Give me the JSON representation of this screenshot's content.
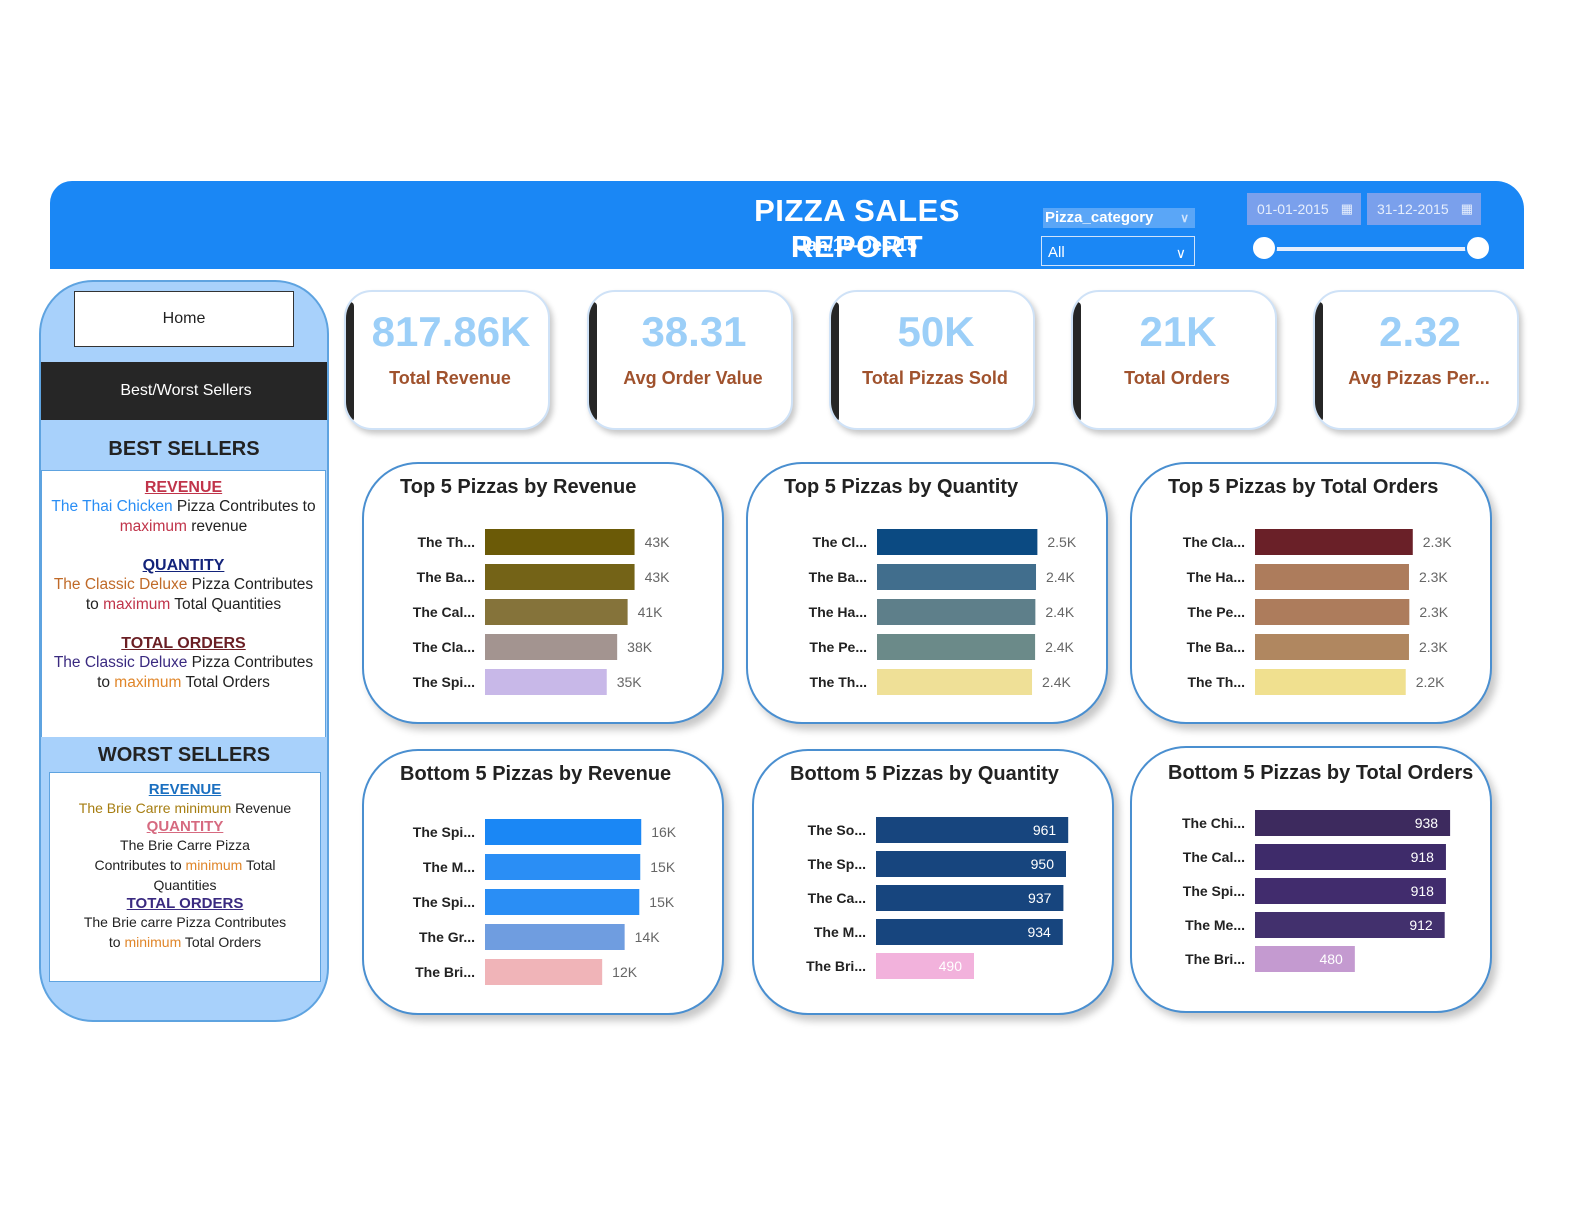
{
  "header": {
    "title": "PIZZA SALES REPORT",
    "subtitle": "Jan/15-Dec/15",
    "category_label": "Pizza_category",
    "category_value": "All",
    "date_start": "01-01-2015",
    "date_end": "31-12-2015",
    "colors": {
      "band": "#1a87f5"
    }
  },
  "sidebar": {
    "home_label": "Home",
    "best_worst_label": "Best/Worst Sellers",
    "best_title": "BEST SELLERS",
    "worst_title": "WORST SELLERS",
    "best": {
      "revenue_h": "REVENUE",
      "revenue_1": "The Thai Chicken",
      "revenue_2": " Pizza Contributes to",
      "revenue_3": "maximum",
      "revenue_4": " revenue",
      "quantity_h": "QUANTITY",
      "quantity_1": "The Classic Deluxe",
      "quantity_2": " Pizza Contributes",
      "quantity_3": "to ",
      "quantity_4": "maximum",
      "quantity_5": " Total Quantities",
      "orders_h": "TOTAL ORDERS",
      "orders_1": "The Classic Deluxe",
      "orders_2": " Pizza Contributes",
      "orders_3": "to ",
      "orders_4": "maximum",
      "orders_5": " Total Orders"
    },
    "worst": {
      "revenue_h": "REVENUE",
      "revenue_1": "The Brie Carre minimum",
      "revenue_2": " Revenue",
      "quantity_h": "QUANTITY",
      "quantity_1": "The Brie Carre Pizza",
      "quantity_2": "Contributes to ",
      "quantity_3": "minimum",
      "quantity_4": " Total",
      "quantity_5": "Quantities",
      "orders_h": "TOTAL ORDERS",
      "orders_1": "The Brie carre Pizza Contributes",
      "orders_2": "to ",
      "orders_3": "minimum",
      "orders_4": " Total Orders"
    }
  },
  "kpis": [
    {
      "value": "817.86K",
      "label": "Total Revenue"
    },
    {
      "value": "38.31",
      "label": "Avg Order Value"
    },
    {
      "value": "50K",
      "label": "Total Pizzas Sold"
    },
    {
      "value": "21K",
      "label": "Total Orders"
    },
    {
      "value": "2.32",
      "label": "Avg Pizzas Per..."
    }
  ],
  "chart_data": [
    {
      "type": "bar",
      "orientation": "horizontal",
      "title": "Top 5 Pizzas by Revenue",
      "categories": [
        "The Th...",
        "The Ba...",
        "The Cal...",
        "The Cla...",
        "The Spi..."
      ],
      "values": [
        43,
        43,
        41,
        38,
        35
      ],
      "value_labels": [
        "43K",
        "43K",
        "41K",
        "38K",
        "35K"
      ],
      "colors": [
        "#6b5a07",
        "#746317",
        "#85733a",
        "#a39490",
        "#c8b8e8"
      ],
      "label_style": "outside",
      "xlim": [
        0,
        46
      ]
    },
    {
      "type": "bar",
      "orientation": "horizontal",
      "title": "Top 5 Pizzas by Quantity",
      "categories": [
        "The Cl...",
        "The Ba...",
        "The Ha...",
        "The Pe...",
        "The Th..."
      ],
      "values": [
        2453,
        2432,
        2422,
        2418,
        2371
      ],
      "value_labels": [
        "2.5K",
        "2.4K",
        "2.4K",
        "2.4K",
        "2.4K"
      ],
      "colors": [
        "#0b4a82",
        "#416e8d",
        "#5e7f8a",
        "#6b8a89",
        "#efe097"
      ],
      "label_style": "outside",
      "xlim": [
        0,
        2600
      ]
    },
    {
      "type": "bar",
      "orientation": "horizontal",
      "title": "Top 5 Pizzas by Total Orders",
      "categories": [
        "The Cla...",
        "The Ha...",
        "The Pe...",
        "The Ba...",
        "The Th..."
      ],
      "values": [
        2329,
        2273,
        2278,
        2273,
        2225
      ],
      "value_labels": [
        "2.3K",
        "2.3K",
        "2.3K",
        "2.3K",
        "2.2K"
      ],
      "colors": [
        "#6a2028",
        "#ad7c5c",
        "#ad7c5c",
        "#b08760",
        "#f0e08f"
      ],
      "label_style": "outside",
      "xlim": [
        0,
        2480
      ]
    },
    {
      "type": "bar",
      "orientation": "horizontal",
      "title": "Bottom 5 Pizzas by Revenue",
      "categories": [
        "The Spi...",
        "The M...",
        "The Spi...",
        "The Gr...",
        "The Bri..."
      ],
      "values": [
        16,
        15.9,
        15.8,
        14.3,
        12
      ],
      "value_labels": [
        "16K",
        "15K",
        "15K",
        "14K",
        "12K"
      ],
      "colors": [
        "#1a87f5",
        "#2a8ef5",
        "#2a8ef5",
        "#6f9de0",
        "#f0b4b8"
      ],
      "label_style": "outside",
      "xlim": [
        0,
        17
      ]
    },
    {
      "type": "bar",
      "orientation": "horizontal",
      "title": "Bottom 5 Pizzas by Quantity",
      "categories": [
        "The So...",
        "The Sp...",
        "The Ca...",
        "The M...",
        "The Bri..."
      ],
      "values": [
        961,
        950,
        937,
        934,
        490
      ],
      "value_labels": [
        "961",
        "950",
        "937",
        "934",
        "490"
      ],
      "colors": [
        "#17457e",
        "#17457e",
        "#17457e",
        "#17457e",
        "#f2b2dc"
      ],
      "label_style": "inside",
      "xlim": [
        0,
        1000
      ]
    },
    {
      "type": "bar",
      "orientation": "horizontal",
      "title": "Bottom 5 Pizzas by Total Orders",
      "categories": [
        "The Chi...",
        "The Cal...",
        "The Spi...",
        "The Me...",
        "The Bri..."
      ],
      "values": [
        938,
        918,
        918,
        912,
        480
      ],
      "value_labels": [
        "938",
        "918",
        "918",
        "912",
        "480"
      ],
      "colors": [
        "#3d2a5e",
        "#3e2b6a",
        "#412c6d",
        "#42306d",
        "#c49ad0"
      ],
      "label_style": "inside",
      "xlim": [
        0,
        1000
      ]
    }
  ]
}
